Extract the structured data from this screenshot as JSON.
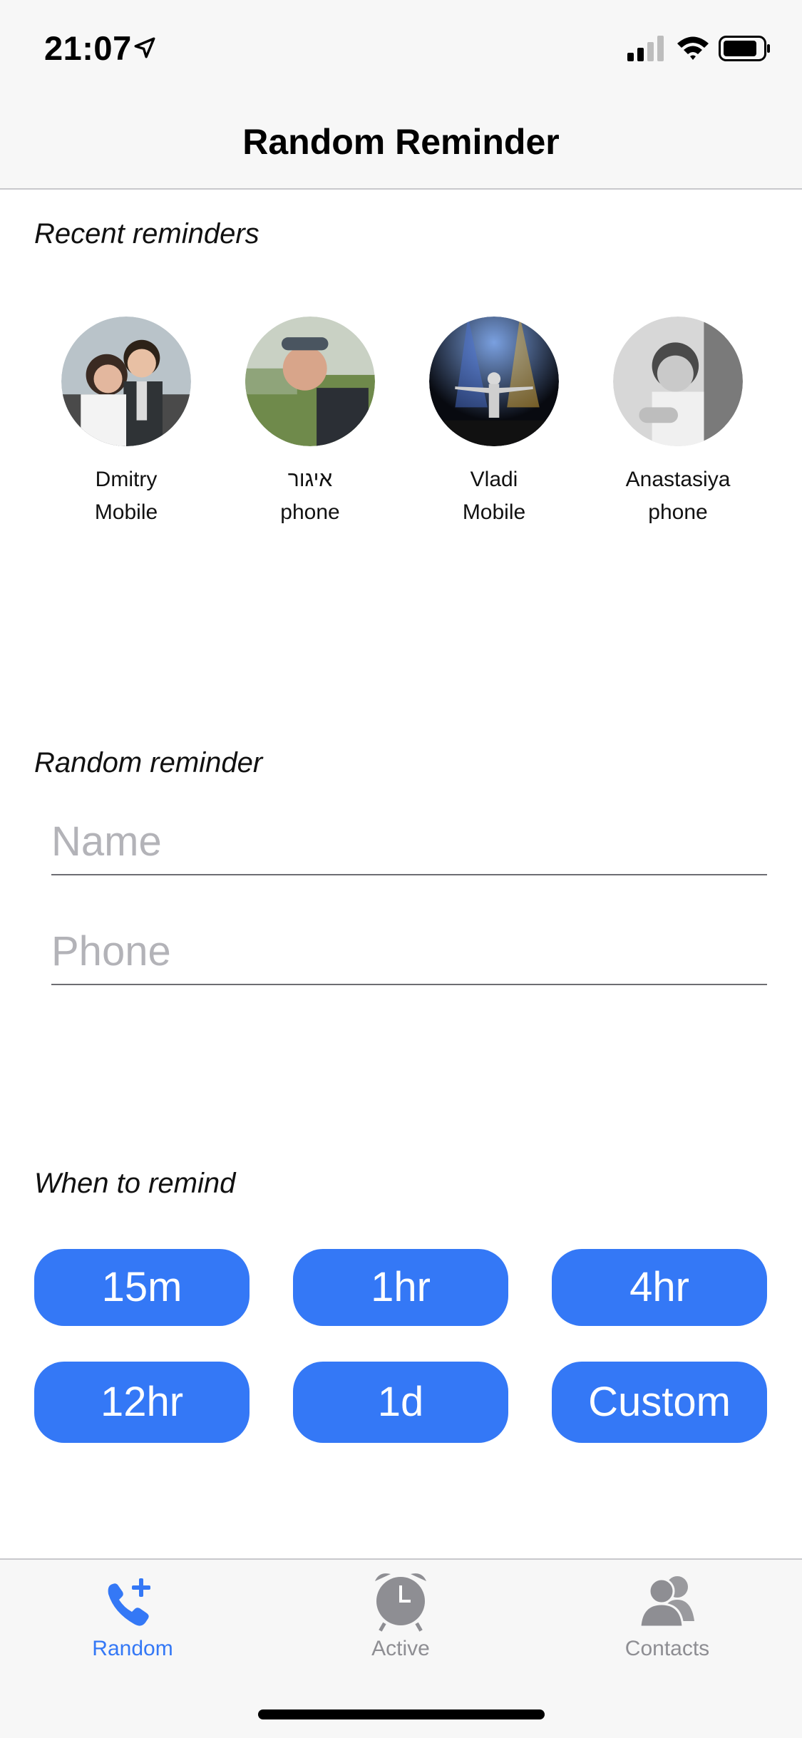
{
  "status_bar": {
    "time": "21:07"
  },
  "nav": {
    "title": "Random Reminder"
  },
  "recent": {
    "heading": "Recent reminders",
    "items": [
      {
        "name": "Dmitry",
        "type": "Mobile"
      },
      {
        "name": "איגור",
        "type": "phone"
      },
      {
        "name": "Vladi",
        "type": "Mobile"
      },
      {
        "name": "Anastasiya",
        "type": "phone"
      }
    ]
  },
  "random": {
    "heading": "Random reminder",
    "name_placeholder": "Name",
    "phone_placeholder": "Phone"
  },
  "when": {
    "heading": "When to remind",
    "buttons": [
      "15m",
      "1hr",
      "4hr",
      "12hr",
      "1d",
      "Custom"
    ]
  },
  "tabs": [
    {
      "label": "Random",
      "icon": "phone-plus-icon",
      "active": true
    },
    {
      "label": "Active",
      "icon": "alarm-clock-icon",
      "active": false
    },
    {
      "label": "Contacts",
      "icon": "contacts-icon",
      "active": false
    }
  ],
  "colors": {
    "accent": "#3478f6",
    "inactive": "#8e8e93"
  }
}
